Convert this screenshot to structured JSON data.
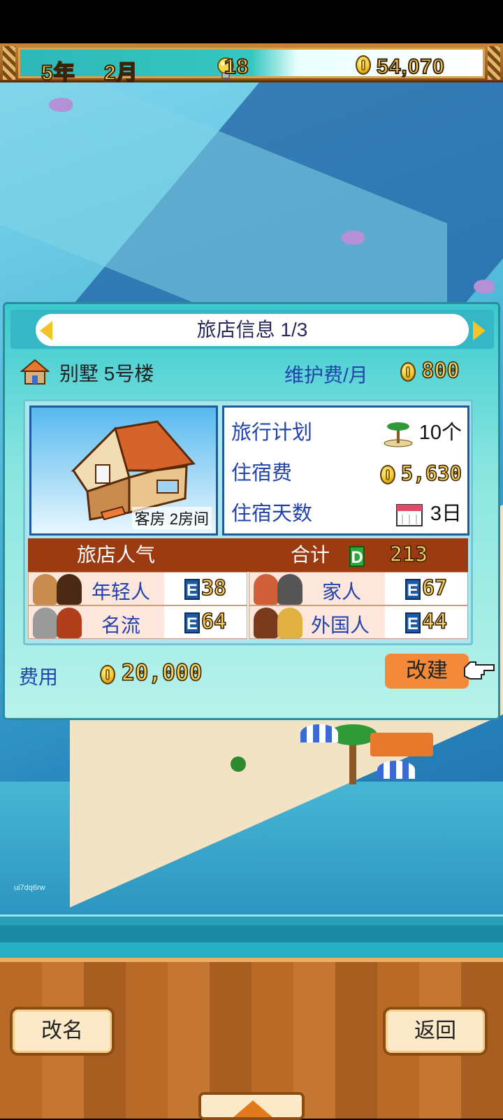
{
  "hud": {
    "year": "5年",
    "month": "2月",
    "ideas": "18",
    "money": "54,070"
  },
  "dialog": {
    "title": "旅店信息 1/3",
    "hotel_name": "别墅 5号楼",
    "maintenance_label": "维护费/月",
    "maintenance_value": "800",
    "room_caption": "客房 2房间",
    "stats": [
      {
        "label": "旅行计划",
        "value": "10个",
        "icon": "island-icon"
      },
      {
        "label": "住宿费",
        "value": "5,630",
        "icon": "coin-icon"
      },
      {
        "label": "住宿天数",
        "value": "3日",
        "icon": "calendar-icon"
      }
    ],
    "popularity": {
      "title": "旅店人气",
      "total_label": "合计",
      "total_grade": "D",
      "total_value": "213",
      "groups": [
        {
          "label": "年轻人",
          "grade": "E",
          "value": "38"
        },
        {
          "label": "家人",
          "grade": "E",
          "value": "67"
        },
        {
          "label": "名流",
          "grade": "E",
          "value": "64"
        },
        {
          "label": "外国人",
          "grade": "E",
          "value": "44"
        }
      ]
    },
    "cost_label": "费用",
    "cost_value": "20,000",
    "rebuild_label": "改建"
  },
  "bottom": {
    "rename_label": "改名",
    "back_label": "返回"
  },
  "watermark": "ui7dq6rw",
  "colors": {
    "dialog_bg": "#39c9cf",
    "popularity_header": "#9c3a12",
    "label_blue": "#2244aa",
    "gold": "#f3d15a",
    "rebuild_button": "#f38a3a"
  }
}
